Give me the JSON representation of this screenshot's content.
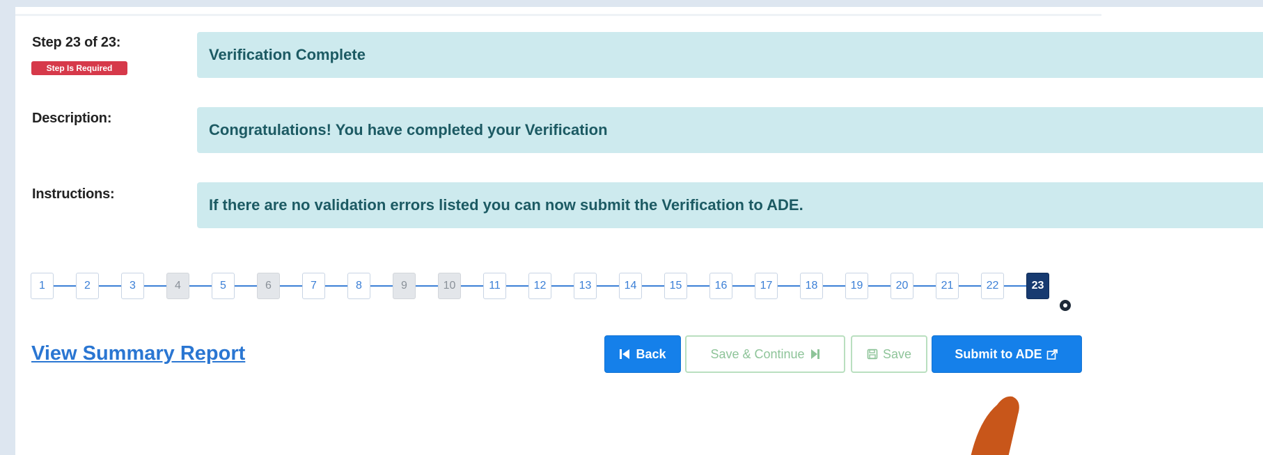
{
  "step": {
    "label": "Step 23 of 23:",
    "badge": "Step Is Required",
    "title": "Verification Complete"
  },
  "description": {
    "label": "Description:",
    "text": "Congratulations! You have completed your Verification"
  },
  "instructions": {
    "label": "Instructions:",
    "text": "If there are no validation errors listed you can now submit the Verification to ADE."
  },
  "stepper": {
    "steps": [
      {
        "n": "1",
        "state": "normal"
      },
      {
        "n": "2",
        "state": "normal"
      },
      {
        "n": "3",
        "state": "normal"
      },
      {
        "n": "4",
        "state": "skipped"
      },
      {
        "n": "5",
        "state": "normal"
      },
      {
        "n": "6",
        "state": "skipped"
      },
      {
        "n": "7",
        "state": "normal"
      },
      {
        "n": "8",
        "state": "normal"
      },
      {
        "n": "9",
        "state": "skipped"
      },
      {
        "n": "10",
        "state": "skipped"
      },
      {
        "n": "11",
        "state": "normal"
      },
      {
        "n": "12",
        "state": "normal"
      },
      {
        "n": "13",
        "state": "normal"
      },
      {
        "n": "14",
        "state": "normal"
      },
      {
        "n": "15",
        "state": "normal"
      },
      {
        "n": "16",
        "state": "normal"
      },
      {
        "n": "17",
        "state": "normal"
      },
      {
        "n": "18",
        "state": "normal"
      },
      {
        "n": "19",
        "state": "normal"
      },
      {
        "n": "20",
        "state": "normal"
      },
      {
        "n": "21",
        "state": "normal"
      },
      {
        "n": "22",
        "state": "normal"
      },
      {
        "n": "23",
        "state": "current"
      }
    ]
  },
  "actions": {
    "summary_link": "View Summary Report",
    "back": "Back",
    "save_continue": "Save & Continue",
    "save": "Save",
    "submit": "Submit to ADE"
  },
  "colors": {
    "accent": "#1580ea",
    "info_bg": "#cdeaee",
    "info_text": "#1c5a63",
    "required": "#d6394a",
    "current_step": "#173a70",
    "cursor": "#c8561a"
  },
  "icons": {
    "back": "step-backward-icon",
    "save_continue": "step-forward-icon",
    "save": "floppy-disk-icon",
    "submit": "share-external-icon"
  }
}
